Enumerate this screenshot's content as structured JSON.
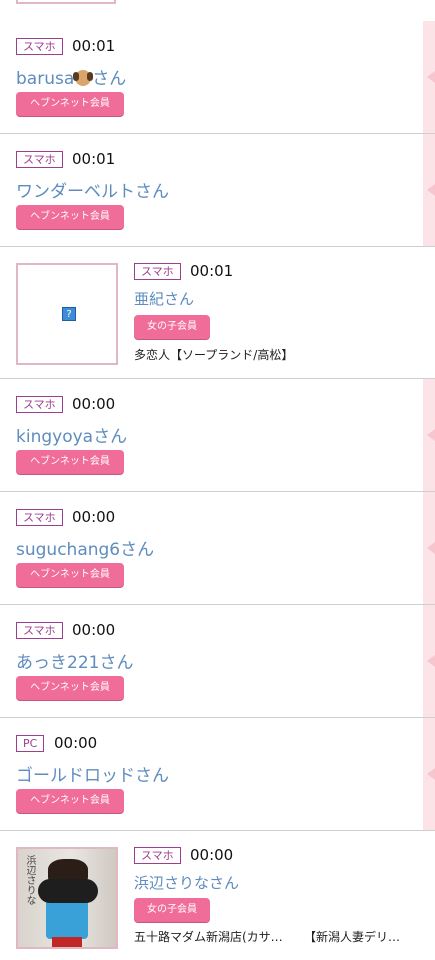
{
  "rows": [
    {
      "badge": "スマホ",
      "time": "00:01",
      "name_prefix": "barusa",
      "name_suffix": "さん",
      "emoji": "dog-face",
      "tag": "ヘブンネット会員"
    },
    {
      "badge": "スマホ",
      "time": "00:01",
      "name": "ワンダーベルトさん",
      "tag": "ヘブンネット会員"
    },
    {
      "badge": "スマホ",
      "time": "00:01",
      "name": "亜紀さん",
      "tag": "女の子会員",
      "shop": "多恋人【ソープランド/高松】",
      "thumb_placeholder": "?"
    },
    {
      "badge": "スマホ",
      "time": "00:00",
      "name": "kingyoyaさん",
      "tag": "ヘブンネット会員"
    },
    {
      "badge": "スマホ",
      "time": "00:00",
      "name": "suguchang6さん",
      "tag": "ヘブンネット会員"
    },
    {
      "badge": "スマホ",
      "time": "00:00",
      "name": "あっき221さん",
      "tag": "ヘブンネット会員"
    },
    {
      "badge": "PC",
      "time": "00:00",
      "name": "ゴールドロッドさん",
      "tag": "ヘブンネット会員"
    },
    {
      "badge": "スマホ",
      "time": "00:00",
      "name": "浜辺さりなさん",
      "tag": "女の子会員",
      "shop": "五十路マダム新潟店(カサ…",
      "shop2": "【新潟人妻デリ…",
      "photo_text": "浜辺さりな"
    }
  ],
  "colors": {
    "accent_pink": "#f06d99",
    "badge_purple": "#9c3f8d",
    "name_blue": "#5e8cbf",
    "side_pink": "#fce3e7"
  }
}
